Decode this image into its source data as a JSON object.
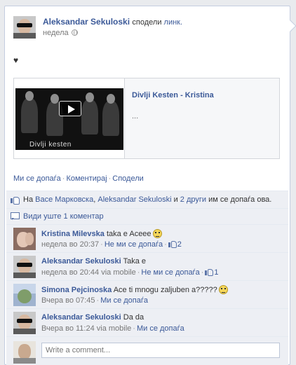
{
  "post": {
    "author": "Aleksandar Sekuloski",
    "verb_prefix": "сподели ",
    "verb_link": "линк.",
    "time": "недела",
    "status_text": "♥",
    "share": {
      "title": "Divlji Kesten - Kristina",
      "description": "...",
      "thumb_caption": "Divlji kesten"
    },
    "actions": {
      "like": "Ми се допаѓа",
      "comment": "Коментирај",
      "share": "Сподели"
    }
  },
  "likes_row": {
    "prefix": "На ",
    "person1": "Васе Марковска",
    "sep1": ", ",
    "person2": "Aleksandar Sekuloski",
    "and": " и ",
    "others": "2 други",
    "suffix": " им се допаѓа ова."
  },
  "more_comments": "Види уште 1 коментар",
  "comments": [
    {
      "author": "Kristina Milevska",
      "text": "taka e Aceee",
      "time": "недела во 20:37",
      "via": "",
      "action": "Не ми се допаѓа",
      "likes": "2"
    },
    {
      "author": "Aleksandar Sekuloski",
      "text": "Taka e",
      "time": "недела во 20:44",
      "via": " via mobile",
      "action": "Не ми се допаѓа",
      "likes": "1"
    },
    {
      "author": "Simona Pejcinoska",
      "text": "Ace ti mnogu zaljuben a?????",
      "time": "Вчера во 07:45",
      "via": "",
      "action": "Ми се допаѓа",
      "likes": ""
    },
    {
      "author": "Aleksandar Sekuloski",
      "text": "Da da",
      "time": "Вчера во 11:24",
      "via": " via mobile",
      "action": "Ми се допаѓа",
      "likes": ""
    }
  ],
  "comment_input": {
    "placeholder": "Write a comment..."
  },
  "colors": {
    "link": "#3b5998",
    "ufi_bg": "#edeff4",
    "border": "#c4cde0"
  }
}
